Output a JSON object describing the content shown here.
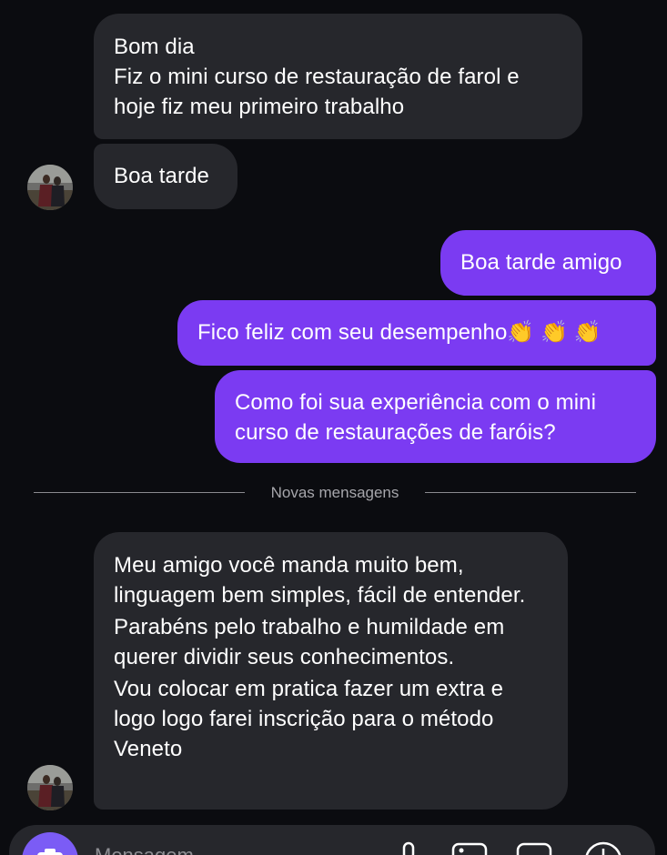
{
  "messages": [
    {
      "lines": [
        "Bom dia",
        "Fiz o mini curso de restauração de farol e hoje fiz meu primeiro trabalho"
      ]
    },
    {
      "lines": [
        "Boa tarde"
      ]
    },
    {
      "lines": [
        "Boa tarde amigo"
      ]
    },
    {
      "lines": [
        "Fico feliz com seu desempenho👏 👏 👏"
      ]
    },
    {
      "lines": [
        "Como foi sua experiência com o mini curso de restaurações de faróis?"
      ]
    },
    {
      "lines": [
        "Meu amigo você manda muito bem, linguagem bem simples, fácil de entender.",
        "Parabéns pelo trabalho e humildade em querer dividir seus conhecimentos.",
        "Vou colocar em pratica fazer um extra e logo logo farei inscrição para o método Veneto"
      ]
    }
  ],
  "divider": {
    "label": "Novas mensagens"
  },
  "composer": {
    "placeholder": "Mensagem..."
  },
  "colors": {
    "background": "#0b0c10",
    "incoming_bubble": "#26272c",
    "outgoing_bubble": "#7b3bf2",
    "accent": "#7b5cf5"
  },
  "icons": [
    "camera-icon",
    "microphone-icon",
    "image-icon",
    "sticker-icon",
    "add-icon"
  ]
}
